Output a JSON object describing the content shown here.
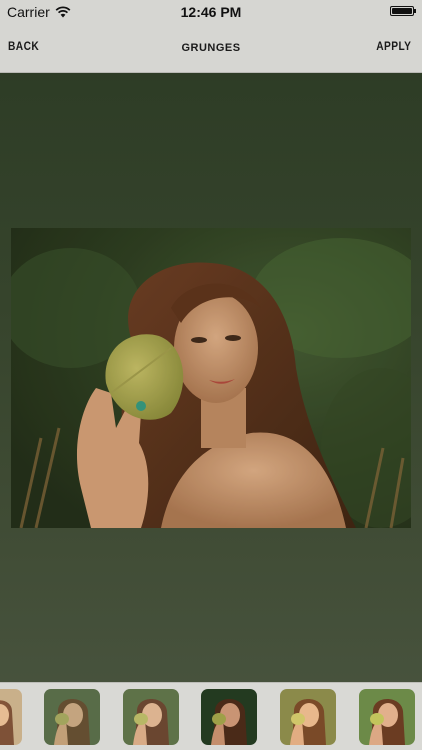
{
  "status_bar": {
    "carrier": "Carrier",
    "time": "12:46 PM"
  },
  "nav": {
    "back_label": "BACK",
    "title": "GRUNGES",
    "apply_label": "APPLY"
  },
  "photo": {
    "description_icon": "photo-preview"
  },
  "filters": {
    "count_visible": 6,
    "thumbnails": [
      {
        "name": "filter-thumb-1",
        "tint": "#c9b08a"
      },
      {
        "name": "filter-thumb-2",
        "tint": "#6d7f5a"
      },
      {
        "name": "filter-thumb-3",
        "tint": "#7d8e62"
      },
      {
        "name": "filter-thumb-4",
        "tint": "#2f4a2a"
      },
      {
        "name": "filter-thumb-5",
        "tint": "#a39454"
      },
      {
        "name": "filter-thumb-6",
        "tint": "#8fa25e"
      }
    ]
  },
  "colors": {
    "bar_bg": "#d6d6d2",
    "canvas_top": "#2b3a24",
    "canvas_bottom": "#4a5540"
  }
}
